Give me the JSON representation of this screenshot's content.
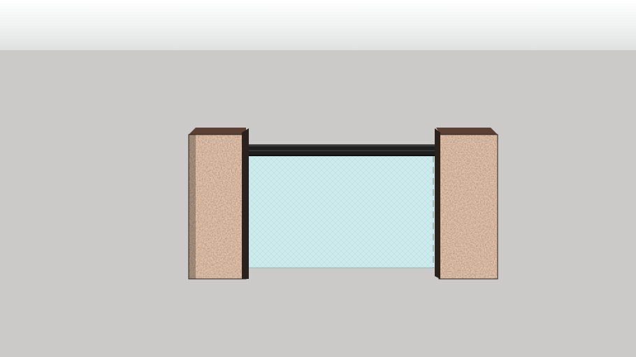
{
  "scene": {
    "sky_color_top": "#ffffff",
    "sky_color_bottom": "#dfe1e1",
    "ground_color": "#cbcac8",
    "pillar_stone_color": "#8a6a58",
    "pillar_shadow_color": "#2b221e",
    "rail_color": "#1e1e1e",
    "glass_color": "#cfeaed"
  }
}
